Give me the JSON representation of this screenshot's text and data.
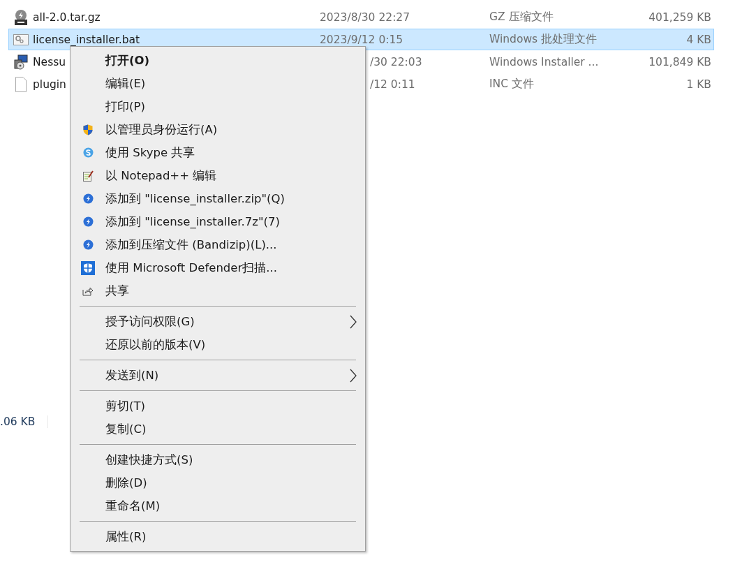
{
  "files": [
    {
      "name": "all-2.0.tar.gz",
      "kind": "gz",
      "date": "2023/8/30 22:27",
      "type": "GZ 压缩文件",
      "size": "401,259 KB",
      "selected": false
    },
    {
      "name": "license_installer.bat",
      "kind": "bat",
      "date": "2023/9/12 0:15",
      "type": "Windows 批处理文件",
      "size": "4 KB",
      "selected": true
    },
    {
      "name": "Nessu",
      "kind": "msi",
      "date": "/30 22:03",
      "type": "Windows Installer ...",
      "size": "101,849 KB",
      "selected": false
    },
    {
      "name": "plugin",
      "kind": "file",
      "date": "/12 0:11",
      "type": "INC 文件",
      "size": "1 KB",
      "selected": false
    }
  ],
  "status_bar": {
    "size": ".06 KB"
  },
  "context_menu": {
    "groups": [
      [
        {
          "label": "打开(O)",
          "kind": "plain",
          "default": true,
          "submenu": false
        },
        {
          "label": "编辑(E)",
          "kind": "plain",
          "default": false,
          "submenu": false
        },
        {
          "label": "打印(P)",
          "kind": "plain",
          "default": false,
          "submenu": false
        },
        {
          "label": "以管理员身份运行(A)",
          "kind": "shield",
          "default": false,
          "submenu": false
        },
        {
          "label": "使用 Skype 共享",
          "kind": "skype",
          "default": false,
          "submenu": false
        },
        {
          "label": "以 Notepad++ 编辑",
          "kind": "notepad",
          "default": false,
          "submenu": false
        },
        {
          "label": "添加到 \"license_installer.zip\"(Q)",
          "kind": "bandizip",
          "default": false,
          "submenu": false
        },
        {
          "label": "添加到 \"license_installer.7z\"(7)",
          "kind": "bandizip",
          "default": false,
          "submenu": false
        },
        {
          "label": "添加到压缩文件 (Bandizip)(L)...",
          "kind": "bandizip",
          "default": false,
          "submenu": false
        },
        {
          "label": "使用 Microsoft Defender扫描...",
          "kind": "defender",
          "default": false,
          "submenu": false
        },
        {
          "label": "共享",
          "kind": "share",
          "default": false,
          "submenu": false
        }
      ],
      [
        {
          "label": "授予访问权限(G)",
          "kind": "plain",
          "default": false,
          "submenu": true
        },
        {
          "label": "还原以前的版本(V)",
          "kind": "plain",
          "default": false,
          "submenu": false
        }
      ],
      [
        {
          "label": "发送到(N)",
          "kind": "plain",
          "default": false,
          "submenu": true
        }
      ],
      [
        {
          "label": "剪切(T)",
          "kind": "plain",
          "default": false,
          "submenu": false
        },
        {
          "label": "复制(C)",
          "kind": "plain",
          "default": false,
          "submenu": false
        }
      ],
      [
        {
          "label": "创建快捷方式(S)",
          "kind": "plain",
          "default": false,
          "submenu": false
        },
        {
          "label": "删除(D)",
          "kind": "plain",
          "default": false,
          "submenu": false
        },
        {
          "label": "重命名(M)",
          "kind": "plain",
          "default": false,
          "submenu": false
        }
      ],
      [
        {
          "label": "属性(R)",
          "kind": "plain",
          "default": false,
          "submenu": false
        }
      ]
    ]
  }
}
